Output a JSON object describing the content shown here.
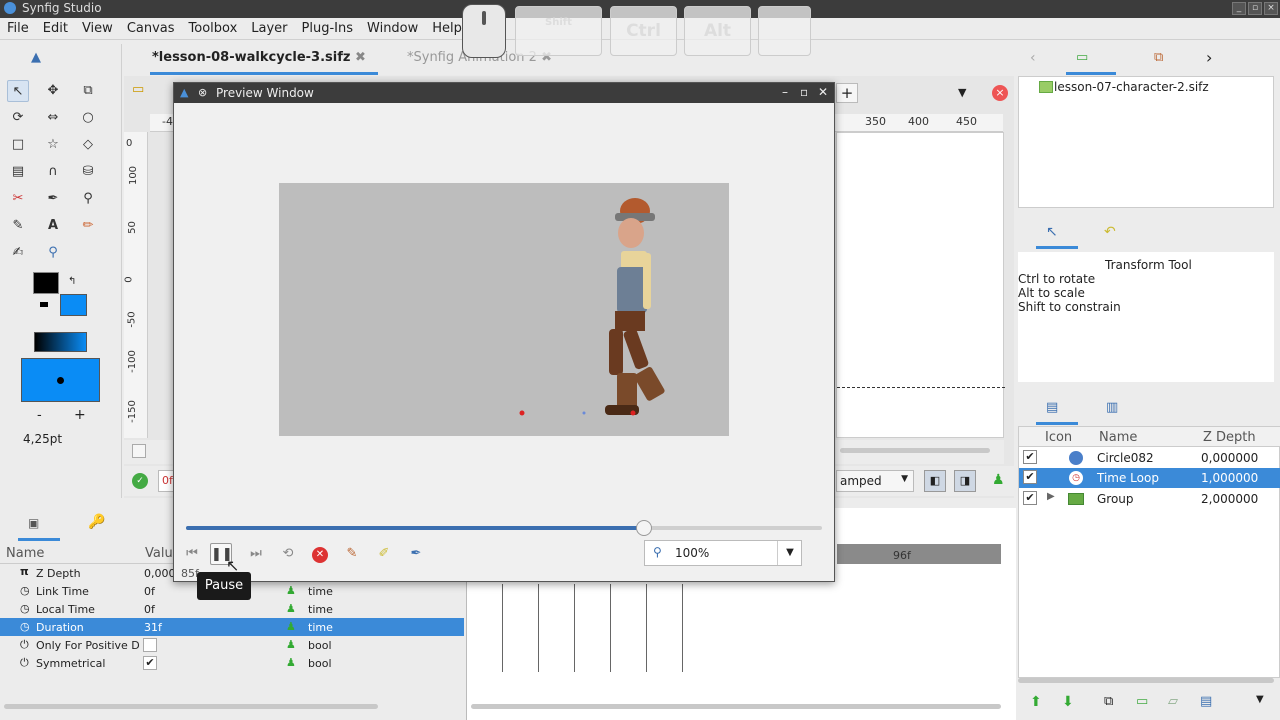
{
  "window": {
    "title": "Synfig Studio"
  },
  "menu": [
    "File",
    "Edit",
    "View",
    "Canvas",
    "Toolbox",
    "Layer",
    "Plug-Ins",
    "Window",
    "Help"
  ],
  "keys": {
    "shift": "Shift",
    "ctrl": "Ctrl",
    "alt": "Alt"
  },
  "tabs": [
    {
      "label": "*lesson-08-walkcycle-3.sifz",
      "active": true
    },
    {
      "label": "*Synfig Animation 2",
      "active": false
    }
  ],
  "toolbox": {
    "brush_size": "4,25pt",
    "minus": "-",
    "plus": "+",
    "outline_color": "#000000",
    "fill_color": "#0a8cf5"
  },
  "rulers": {
    "top": [
      "-4",
      "350",
      "400",
      "450"
    ],
    "left": [
      "0",
      "100",
      "50",
      "0",
      "-50",
      "-100",
      "-150"
    ]
  },
  "canvas_bar": {
    "frame": "0f",
    "interp": "amped"
  },
  "preview": {
    "title": "Preview Window",
    "zoom": "100%",
    "progress": 0.72,
    "tooltip": "Pause",
    "under_labels": "85f"
  },
  "library": {
    "file": "lesson-07-character-2.sifz"
  },
  "tool_options": {
    "title": "Transform Tool",
    "lines": [
      "Ctrl to rotate",
      "Alt to scale",
      "Shift to constrain"
    ]
  },
  "layers": {
    "headers": [
      "Icon",
      "Name",
      "Z Depth"
    ],
    "rows": [
      {
        "name": "Circle082",
        "z": "0,000000",
        "selected": false,
        "icon": "circle-icon"
      },
      {
        "name": "Time Loop",
        "z": "1,000000",
        "selected": true,
        "icon": "time-loop-icon"
      },
      {
        "name": "Group",
        "z": "2,000000",
        "selected": false,
        "icon": "folder-icon"
      }
    ]
  },
  "params": {
    "headers": [
      "Name",
      "Valu"
    ],
    "rows": [
      {
        "name": "Z Depth",
        "value": "0,000",
        "type": "",
        "selected": false,
        "icon": "pi-icon"
      },
      {
        "name": "Link Time",
        "value": "0f",
        "type": "time",
        "selected": false,
        "icon": "clock-icon"
      },
      {
        "name": "Local Time",
        "value": "0f",
        "type": "time",
        "selected": false,
        "icon": "clock-icon"
      },
      {
        "name": "Duration",
        "value": "31f",
        "type": "time",
        "selected": true,
        "icon": "clock-icon"
      },
      {
        "name": "Only For Positive Du",
        "value": "",
        "type": "bool",
        "selected": false,
        "icon": "power-icon"
      },
      {
        "name": "Symmetrical",
        "value": "",
        "type": "bool",
        "selected": false,
        "icon": "power-icon"
      }
    ]
  },
  "timeline": {
    "marker": "96f"
  }
}
